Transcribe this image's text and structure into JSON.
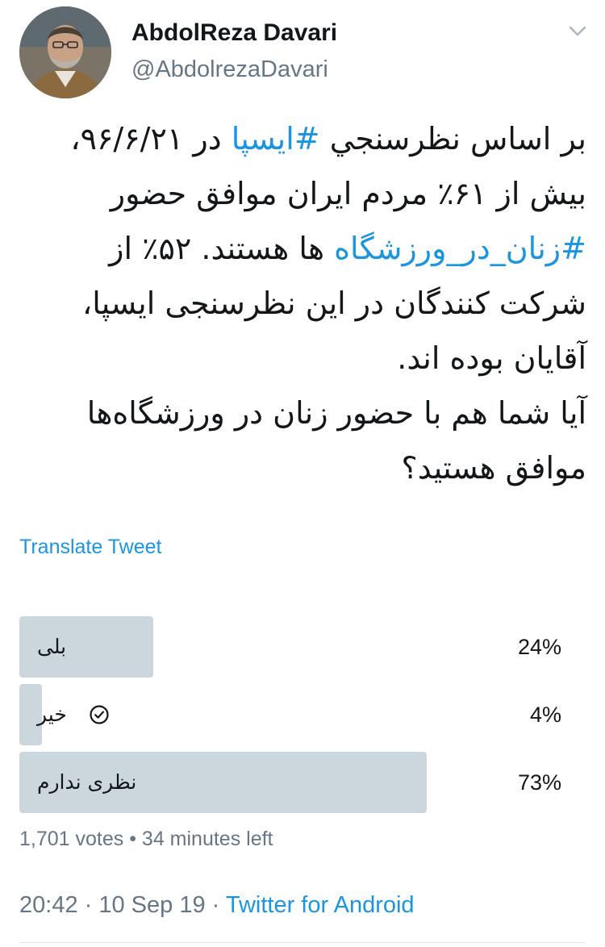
{
  "user": {
    "display_name": "AbdolReza Davari",
    "handle": "@AbdolrezaDavari"
  },
  "tweet": {
    "line1_before": "بر اساس نظرسنجي ",
    "hashtag_ispa": "#ایسپا",
    "line1_after": " در ۹۶/۶/۲۱،",
    "line2": "بیش از ۶۱٪ مردم ایران موافق حضور",
    "hashtag_women": "#زنان_در_ورزشگاه",
    "line3_after": " ها هستند. ۵۲٪ از",
    "line4": "شرکت کنندگان در این نظرسنجی ایسپا،",
    "line5": "آقایان بوده اند.",
    "line6": "آیا شما هم با حضور زنان در ورزشگاه‌ها",
    "line7": "موافق هستید؟"
  },
  "translate_label": "Translate Tweet",
  "poll": {
    "options": [
      {
        "label": "بلی",
        "percent_label": "24%",
        "percent": 24,
        "selected": false
      },
      {
        "label": "خیر",
        "percent_label": "4%",
        "percent": 4,
        "selected": true
      },
      {
        "label": "نظری ندارم",
        "percent_label": "73%",
        "percent": 73,
        "selected": false
      }
    ],
    "votes_text": "1,701 votes",
    "separator": " • ",
    "time_left": "34 minutes left"
  },
  "meta": {
    "time": "20:42",
    "sep1": " · ",
    "date": "10 Sep 19",
    "sep2": " · ",
    "source": "Twitter for Android"
  },
  "colors": {
    "link": "#1b95e0",
    "secondary_text": "#657786",
    "poll_bar": "#ccd6dd"
  },
  "icons": {
    "menu": "chevron-down-icon",
    "selected_option": "check-circle-icon"
  }
}
